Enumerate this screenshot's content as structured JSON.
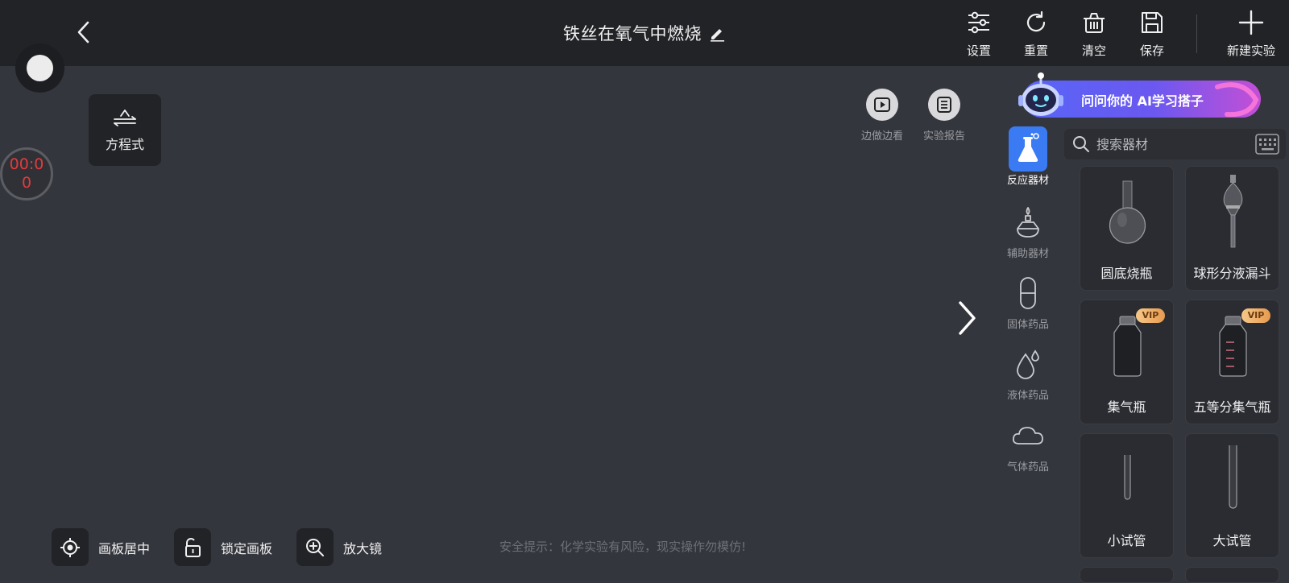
{
  "header": {
    "title": "铁丝在氧气中燃烧",
    "actions": [
      {
        "label": "设置",
        "icon": "settings-sliders-icon"
      },
      {
        "label": "重置",
        "icon": "reset-icon"
      },
      {
        "label": "清空",
        "icon": "trash-icon"
      },
      {
        "label": "保存",
        "icon": "save-icon"
      },
      {
        "label": "新建实验",
        "icon": "plus-icon"
      }
    ]
  },
  "left": {
    "timer": "00:00",
    "equation_label": "方程式"
  },
  "canvas_actions": [
    {
      "label": "边做边看",
      "icon": "play-video-icon"
    },
    {
      "label": "实验报告",
      "icon": "report-list-icon"
    }
  ],
  "bottom_tools": [
    {
      "label": "画板居中",
      "icon": "crosshair-icon"
    },
    {
      "label": "锁定画板",
      "icon": "unlock-icon"
    },
    {
      "label": "放大镜",
      "icon": "zoom-in-icon"
    }
  ],
  "safety_tip": "安全提示：化学实验有风险，现实操作勿模仿!",
  "ai_banner": {
    "text": "问问你的  AI学习搭子"
  },
  "categories": [
    {
      "label": "反应器材",
      "icon": "flask-icon",
      "active": true
    },
    {
      "label": "辅助器材",
      "icon": "alcohol-lamp-icon",
      "active": false
    },
    {
      "label": "固体药品",
      "icon": "capsule-icon",
      "active": false
    },
    {
      "label": "液体药品",
      "icon": "droplet-icon",
      "active": false
    },
    {
      "label": "气体药品",
      "icon": "cloud-icon",
      "active": false
    }
  ],
  "search": {
    "placeholder": "搜索器材"
  },
  "equipment": [
    {
      "label": "圆底烧瓶",
      "vip": false
    },
    {
      "label": "球形分液漏斗",
      "vip": false
    },
    {
      "label": "集气瓶",
      "vip": true,
      "badge": "VIP"
    },
    {
      "label": "五等分集气瓶",
      "vip": true,
      "badge": "VIP"
    },
    {
      "label": "小试管",
      "vip": false
    },
    {
      "label": "大试管",
      "vip": false
    }
  ],
  "colors": {
    "topbar": "#222327",
    "canvas": "#34363d",
    "accent": "#3a7bf4",
    "timer_text": "#e33b3b",
    "vip_gold": "#f6c889"
  }
}
